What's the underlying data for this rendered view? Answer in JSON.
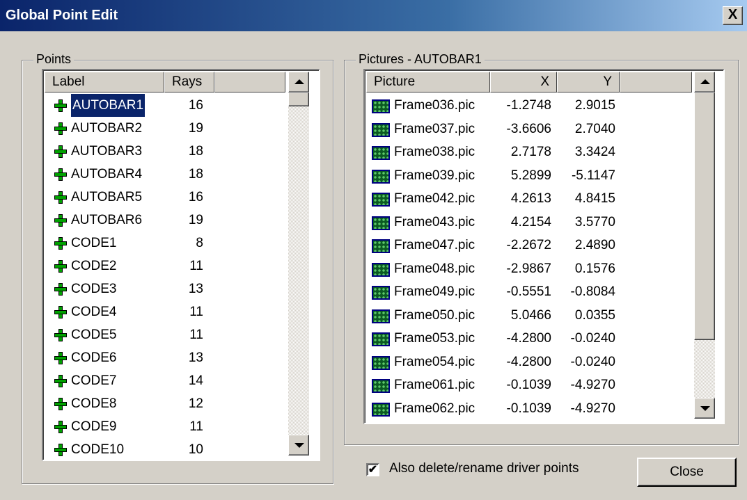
{
  "window": {
    "title": "Global Point Edit",
    "close_glyph": "X"
  },
  "points": {
    "legend": "Points",
    "columns": [
      "Label",
      "Rays"
    ],
    "selected_index": 0,
    "rows": [
      {
        "label": "AUTOBAR1",
        "rays": "16"
      },
      {
        "label": "AUTOBAR2",
        "rays": "19"
      },
      {
        "label": "AUTOBAR3",
        "rays": "18"
      },
      {
        "label": "AUTOBAR4",
        "rays": "18"
      },
      {
        "label": "AUTOBAR5",
        "rays": "16"
      },
      {
        "label": "AUTOBAR6",
        "rays": "19"
      },
      {
        "label": "CODE1",
        "rays": "8"
      },
      {
        "label": "CODE2",
        "rays": "11"
      },
      {
        "label": "CODE3",
        "rays": "13"
      },
      {
        "label": "CODE4",
        "rays": "11"
      },
      {
        "label": "CODE5",
        "rays": "11"
      },
      {
        "label": "CODE6",
        "rays": "13"
      },
      {
        "label": "CODE7",
        "rays": "14"
      },
      {
        "label": "CODE8",
        "rays": "12"
      },
      {
        "label": "CODE9",
        "rays": "11"
      },
      {
        "label": "CODE10",
        "rays": "10"
      }
    ]
  },
  "pictures": {
    "legend": "Pictures - AUTOBAR1",
    "columns": [
      "Picture",
      "X",
      "Y"
    ],
    "rows": [
      {
        "name": "Frame036.pic",
        "x": "-1.2748",
        "y": "2.9015"
      },
      {
        "name": "Frame037.pic",
        "x": "-3.6606",
        "y": "2.7040"
      },
      {
        "name": "Frame038.pic",
        "x": "2.7178",
        "y": "3.3424"
      },
      {
        "name": "Frame039.pic",
        "x": "5.2899",
        "y": "-5.1147"
      },
      {
        "name": "Frame042.pic",
        "x": "4.2613",
        "y": "4.8415"
      },
      {
        "name": "Frame043.pic",
        "x": "4.2154",
        "y": "3.5770"
      },
      {
        "name": "Frame047.pic",
        "x": "-2.2672",
        "y": "2.4890"
      },
      {
        "name": "Frame048.pic",
        "x": "-2.9867",
        "y": "0.1576"
      },
      {
        "name": "Frame049.pic",
        "x": "-0.5551",
        "y": "-0.8084"
      },
      {
        "name": "Frame050.pic",
        "x": "5.0466",
        "y": "0.0355"
      },
      {
        "name": "Frame053.pic",
        "x": "-4.2800",
        "y": "-0.0240"
      },
      {
        "name": "Frame054.pic",
        "x": "-4.2800",
        "y": "-0.0240"
      },
      {
        "name": "Frame061.pic",
        "x": "-0.1039",
        "y": "-4.9270"
      },
      {
        "name": "Frame062.pic",
        "x": "-0.1039",
        "y": "-4.9270"
      }
    ]
  },
  "options": {
    "also_delete_label": "Also delete/rename driver points",
    "also_delete_checked": true,
    "check_glyph": "✔"
  },
  "buttons": {
    "close": "Close"
  },
  "colors": {
    "title_start": "#0a246a",
    "title_end": "#a6caf0",
    "selection": "#0a246a",
    "face": "#d4d0c8"
  }
}
